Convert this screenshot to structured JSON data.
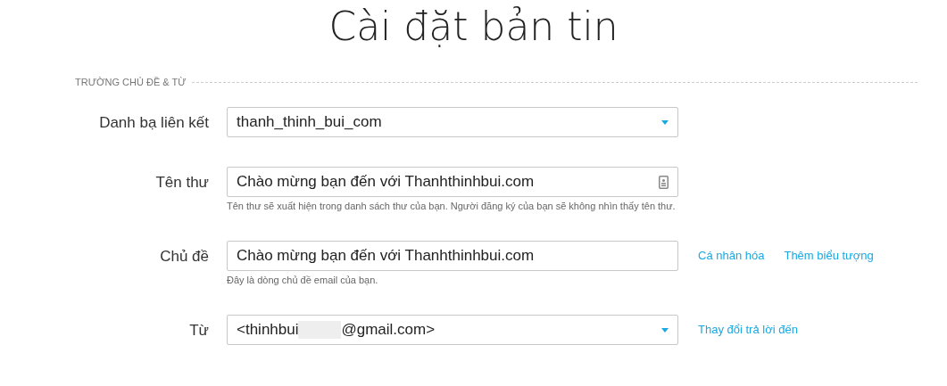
{
  "title": "Cài đặt bản tin",
  "section": {
    "heading": "TRƯỜNG CHỦ ĐỀ & TỪ"
  },
  "fields": [
    {
      "kind": "select",
      "label": "Danh bạ liên kết",
      "value": "thanh_thinh_bui_com"
    },
    {
      "kind": "input",
      "label": "Tên thư",
      "value": "Chào mừng bạn đến với Thanhthinhbui.com",
      "has_icon": true,
      "hint": "Tên thư sẽ xuất hiện trong danh sách thư của bạn. Người đăng ký của bạn sẽ không nhìn thấy tên thư."
    },
    {
      "kind": "input",
      "label": "Chủ đề",
      "value": "Chào mừng bạn đến với Thanhthinhbui.com",
      "hint": "Đây là dòng chủ đề email của bạn.",
      "links": [
        "Cá nhân hóa",
        "Thêm biểu tượng"
      ]
    },
    {
      "kind": "select",
      "label": "Từ",
      "value": "<thinhbui",
      "redacted": true,
      "value_end": "@gmail.com>",
      "links": [
        "Thay đổi trả lời đến"
      ]
    }
  ]
}
